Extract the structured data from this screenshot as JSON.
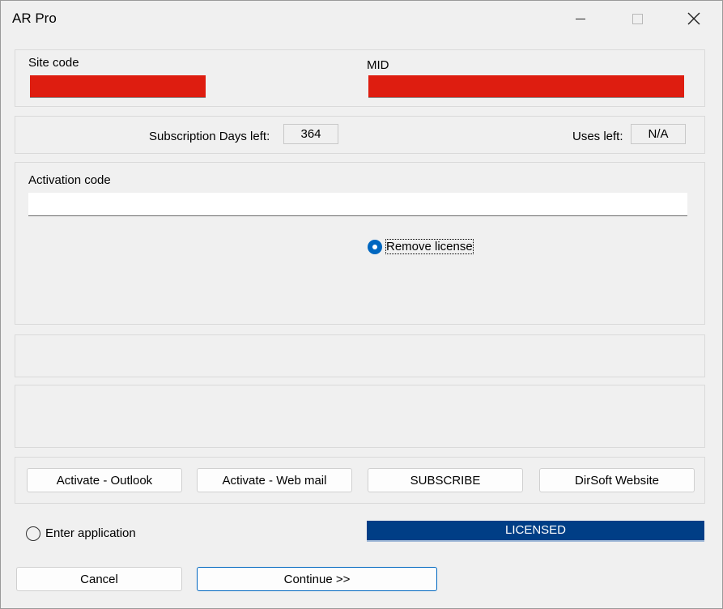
{
  "window": {
    "title": "AR Pro",
    "controls": {
      "minimize": "minimize-icon",
      "maximize": "maximize-icon",
      "close": "close-icon"
    }
  },
  "site": {
    "site_code_label": "Site code",
    "mid_label": "MID",
    "redact_color": "#de1d10"
  },
  "subscription": {
    "days_label": "Subscription Days left:",
    "days_value": "364",
    "uses_label": "Uses left:",
    "uses_value": "N/A"
  },
  "activation": {
    "label": "Activation code",
    "value": "",
    "remove_license_label": "Remove license",
    "remove_license_selected": true
  },
  "buttons": {
    "activate_outlook": "Activate - Outlook",
    "activate_webmail": "Activate - Web mail",
    "subscribe": "SUBSCRIBE",
    "website": "DirSoft Website"
  },
  "footer": {
    "enter_app_label": "Enter application",
    "enter_app_selected": false,
    "status_text": "LICENSED",
    "status_color": "#003e86",
    "cancel_label": "Cancel",
    "continue_label": "Continue >>"
  },
  "colors": {
    "accent": "#0067c0",
    "background": "#f0f0f0"
  }
}
